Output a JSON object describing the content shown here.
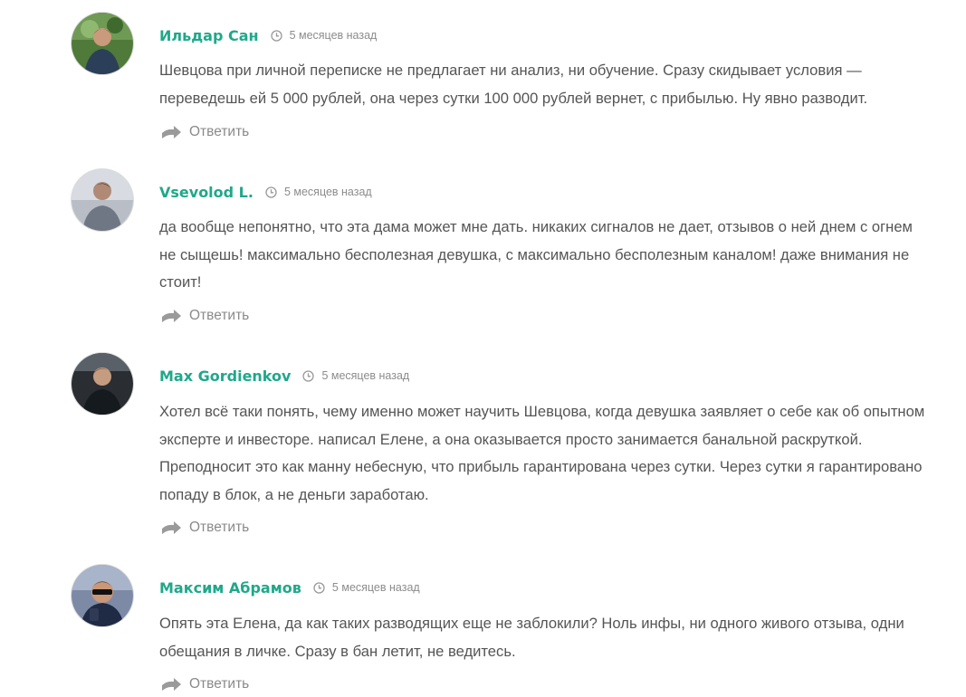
{
  "comments": [
    {
      "author": "Ильдар Сан",
      "time": "5 месяцев назад",
      "text": "Шевцова при личной переписке не предлагает ни анализ, ни обучение. Сразу скидывает условия — переведешь ей 5 000 рублей, она через сутки 100 000 рублей вернет, с прибылью. Ну явно разводит.",
      "reply_label": "Ответить"
    },
    {
      "author": "Vsevolod L.",
      "time": "5 месяцев назад",
      "text": "да вообще непонятно, что эта дама может мне дать. никаких сигналов не дает, отзывов о ней днем с огнем не сыщешь! максимально бесполезная девушка, с максимально бесполезным каналом! даже внимания не стоит!",
      "reply_label": "Ответить"
    },
    {
      "author": "Max Gordienkov",
      "time": "5 месяцев назад",
      "text": "Хотел всё таки понять, чему именно может научить Шевцова, когда девушка заявляет о себе как об опытном эксперте и инвесторе. написал Елене, а она оказывается просто занимается банальной раскруткой. Преподносит это как манну небесную, что прибыль гарантирована через сутки. Через сутки я гарантировано попаду в блок, а не деньги заработаю.",
      "reply_label": "Ответить"
    },
    {
      "author": "Максим Абрамов",
      "time": "5 месяцев назад",
      "text": "Опять эта Елена, да как таких разводящих еще не заблокили? Ноль инфы, ни одного живого отзыва, одни обещания в личке. Сразу в бан летит, не ведитесь.",
      "reply_label": "Ответить"
    }
  ],
  "colors": {
    "author": "#1fa88a",
    "text": "#555555",
    "meta": "#8c8c8c"
  },
  "icons": {
    "time": "clock-icon",
    "reply": "reply-arrow-icon"
  }
}
